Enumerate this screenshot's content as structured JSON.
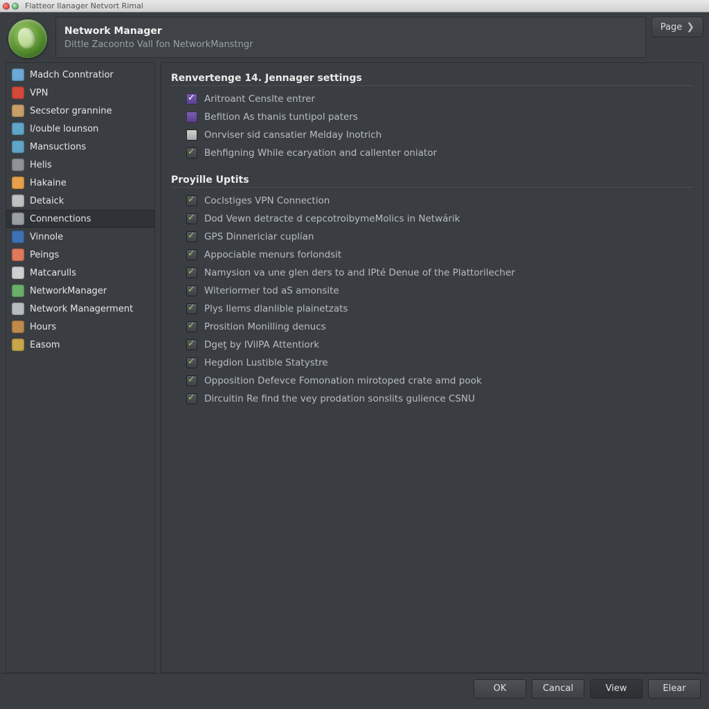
{
  "window": {
    "title": "Flatteor Ilanager Netvort Rimal"
  },
  "header": {
    "title": "Network Manager",
    "subtitle": "Dittle Zacoonto Vall fon NetworkManstngr",
    "page_label": "Page"
  },
  "sidebar": {
    "items": [
      {
        "label": "Madch Conntratior",
        "icon": "globe-gear-icon",
        "color": "#6aa9d8"
      },
      {
        "label": "VPN",
        "icon": "shield-icon",
        "color": "#d24a3a"
      },
      {
        "label": "Secsetor grannine",
        "icon": "drive-icon",
        "color": "#c7a069"
      },
      {
        "label": "I/ouble lounson",
        "icon": "terminal-icon",
        "color": "#5fa6c9"
      },
      {
        "label": "Mansuctions",
        "icon": "calendar-icon",
        "color": "#5fa6c9"
      },
      {
        "label": "Helis",
        "icon": "folder-icon",
        "color": "#8f9396"
      },
      {
        "label": "Hakaine",
        "icon": "flame-icon",
        "color": "#e8a04c"
      },
      {
        "label": "Detaick",
        "icon": "gear-icon",
        "color": "#c0c0c0"
      },
      {
        "label": "Connenctions",
        "icon": "plug-icon",
        "color": "#9aa0a6",
        "selected": true
      },
      {
        "label": "Vinnole",
        "icon": "world-icon",
        "color": "#3d72b4"
      },
      {
        "label": "Peings",
        "icon": "chat-icon",
        "color": "#e0795a"
      },
      {
        "label": "Matcarulls",
        "icon": "toolbox-icon",
        "color": "#d0d0d0"
      },
      {
        "label": "NetworkManager",
        "icon": "network-icon",
        "color": "#6ab06a"
      },
      {
        "label": "Network Managerment",
        "icon": "document-icon",
        "color": "#b8bdc2"
      },
      {
        "label": "Hours",
        "icon": "briefcase-icon",
        "color": "#c08a4a"
      },
      {
        "label": "Easom",
        "icon": "package-icon",
        "color": "#c9a64b"
      }
    ]
  },
  "main": {
    "sections": [
      {
        "title": "Renvertenge 14. Jennager settings",
        "options": [
          {
            "style": "purple",
            "checked": true,
            "label": "Aritroant Censlte entrer"
          },
          {
            "style": "purple",
            "checked": false,
            "label": "Befition As thanis tuntipol paters"
          },
          {
            "style": "grey",
            "checked": false,
            "label": "Onrviser sid cansatier Melday Inotrich"
          },
          {
            "style": "green",
            "checked": true,
            "label": "Behfigning While ecaryation and callenter oniator"
          }
        ]
      },
      {
        "title": "Proyille Uptits",
        "options": [
          {
            "style": "green",
            "checked": true,
            "label": "Coclstiges VPN Connection"
          },
          {
            "style": "green",
            "checked": true,
            "label": "Dod Vewn detracte d cepcotroibymeMolics in Netwárik"
          },
          {
            "style": "green",
            "checked": true,
            "label": "GPS Dinnericiar cuplían"
          },
          {
            "style": "green",
            "checked": true,
            "label": "Appociable menurs forlondsit"
          },
          {
            "style": "green",
            "checked": true,
            "label": "Namysion va une glen ders to and IPté Denue of the Plattorilecher"
          },
          {
            "style": "green",
            "checked": true,
            "label": "Witeriormer tod aS amonsite"
          },
          {
            "style": "green",
            "checked": true,
            "label": "Plys Ilems dlanlible plainetzats"
          },
          {
            "style": "green",
            "checked": true,
            "label": "Prosition Monilling denucs"
          },
          {
            "style": "green",
            "checked": true,
            "label": "Dgeţ by IVilPA Attentiork"
          },
          {
            "style": "green",
            "checked": true,
            "label": "Hegdion Lustible Statystre"
          },
          {
            "style": "green",
            "checked": true,
            "label": "Opposition Defevce Fomonation mirotoped crate amd pook"
          },
          {
            "style": "green",
            "checked": true,
            "label": "Dircuitin Re find the vey prodation sonslits gulience CSNU"
          }
        ]
      }
    ]
  },
  "footer": {
    "buttons": [
      {
        "label": "OK",
        "name": "ok-button"
      },
      {
        "label": "Cancal",
        "name": "cancel-button"
      },
      {
        "label": "View",
        "name": "view-button",
        "dark": true
      },
      {
        "label": "Elear",
        "name": "clear-button"
      }
    ]
  }
}
